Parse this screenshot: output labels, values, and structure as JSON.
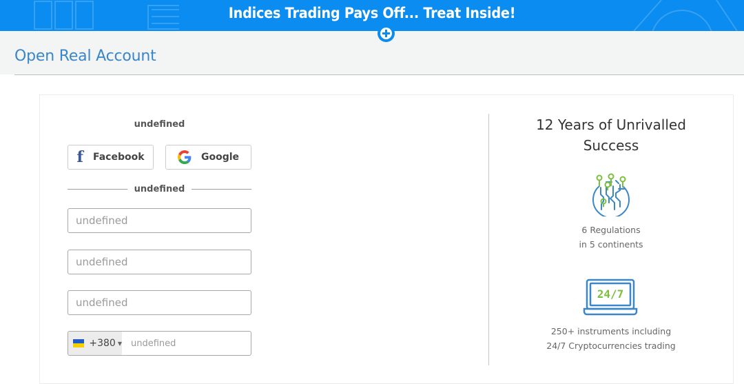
{
  "promo_banner": {
    "text": "Indices Trading Pays Off... Treat Inside!",
    "expand_icon": "plus-circle-icon",
    "background_color": "#0a8cf0"
  },
  "header": {
    "title": "Open Real Account",
    "title_color": "#3a86c8"
  },
  "form": {
    "social_title": "undefined",
    "social_buttons": [
      {
        "label": "Facebook",
        "icon": "facebook-icon"
      },
      {
        "label": "Google",
        "icon": "google-icon"
      }
    ],
    "divider_text": "undefined",
    "fields": [
      {
        "placeholder": "undefined",
        "value": ""
      },
      {
        "placeholder": "undefined",
        "value": ""
      },
      {
        "placeholder": "undefined",
        "value": ""
      }
    ],
    "phone": {
      "country_flag": "ukraine-flag-icon",
      "dial_code": "+380",
      "placeholder": "undefined",
      "value": ""
    }
  },
  "benefits": {
    "title": "12 Years of Unrivalled Success",
    "items": [
      {
        "icon": "globe-network-icon",
        "line1": "6 Regulations",
        "line2": "in 5 continents"
      },
      {
        "icon": "laptop-24-7-icon",
        "icon_text": "24/7",
        "line1": "250+ instruments including",
        "line2": "24/7 Cryptocurrencies trading"
      }
    ]
  }
}
